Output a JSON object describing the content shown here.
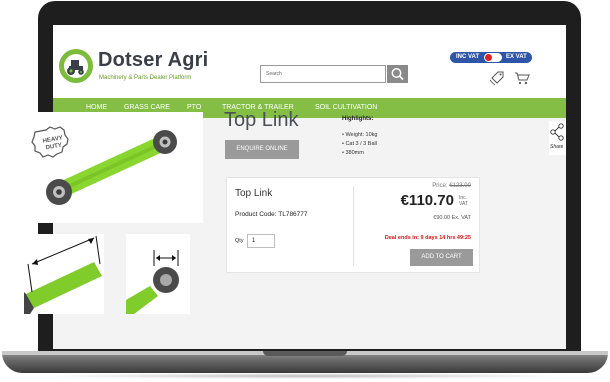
{
  "brand": {
    "name": "Dotser Agri",
    "tagline": "Machinery & Parts Dealer Platform",
    "accent_green": "#84be44",
    "accent_blue": "#2f55a8"
  },
  "header": {
    "search": {
      "placeholder": "Search",
      "icon": "search-icon"
    },
    "vat_toggle": {
      "inc_label": "INC VAT",
      "ex_label": "EX VAT",
      "state": "inc"
    },
    "icons": [
      "price-tag-icon",
      "cart-icon"
    ]
  },
  "nav": {
    "items": [
      {
        "label": "HOME"
      },
      {
        "label": "GRASS CARE"
      },
      {
        "label": "PTO"
      },
      {
        "label": "TRACTOR & TRAILER"
      },
      {
        "label": "SOIL CULTIVATION"
      }
    ],
    "active_index": 3
  },
  "product": {
    "title": "Top Link",
    "enquire_label": "ENQUIRE ONLINE",
    "badge_text": "HEAVY DUTY",
    "highlights_title": "Highlights:",
    "highlights": [
      "• Weight: 10kg",
      "• Cat 3 / 3 Ball",
      "• 380mm"
    ]
  },
  "card": {
    "name": "Top Link",
    "code_label": "Product Code: TL786777",
    "qty_label": "Qty",
    "qty_value": "1",
    "price_was_label": "Price:",
    "price_was": "€123.00",
    "price_now": "€110.70",
    "price_inc_label": "Inc. VAT",
    "price_ex": "€90.00 Ex. VAT",
    "deal": "Deal ends in: 9 days 14 hrs 49:25",
    "add_to_cart_label": "ADD TO CART"
  },
  "share": {
    "label": "Share",
    "icon": "share-icon"
  }
}
